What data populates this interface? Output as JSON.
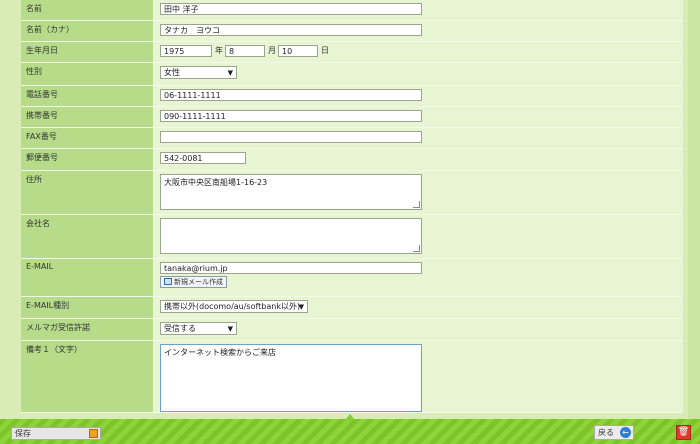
{
  "form": {
    "name": {
      "label": "名前",
      "value": "田中 洋子"
    },
    "kana": {
      "label": "名前（カナ）",
      "value": "タナカ　ヨウコ"
    },
    "birthday": {
      "label": "生年月日",
      "year": "1975",
      "year_unit": "年",
      "month": "8",
      "month_unit": "月",
      "day": "10",
      "day_unit": "日"
    },
    "gender": {
      "label": "性別",
      "value": "女性"
    },
    "phone": {
      "label": "電話番号",
      "value": "06-1111-1111"
    },
    "mobile": {
      "label": "携帯番号",
      "value": "090-1111-1111"
    },
    "fax": {
      "label": "FAX番号",
      "value": ""
    },
    "zip": {
      "label": "郵便番号",
      "value": "542-0081"
    },
    "address": {
      "label": "住所",
      "value": "大阪市中央区南船場1-16-23"
    },
    "company": {
      "label": "会社名",
      "value": ""
    },
    "email": {
      "label": "E-MAIL",
      "value": "tanaka@rium.jp",
      "new_mail_button": "新規メール作成"
    },
    "email_type": {
      "label": "E-MAIL種別",
      "value": "携帯以外(docomo/au/softbank以外)"
    },
    "magazine": {
      "label": "メルマガ受信許諾",
      "value": "受信する"
    },
    "note1": {
      "label": "備考１（文字）",
      "value": "インターネット検索からご来店"
    }
  },
  "footer": {
    "save_label": "保存",
    "back_label": "戻る"
  },
  "icons": {
    "lock": "lock-icon",
    "back": "back-arrow-icon",
    "trash": "trash-icon",
    "mail": "mail-icon"
  },
  "colors": {
    "accent_green": "#7ec32a",
    "label_bg": "#b6dc8a",
    "value_bg": "#e8f5d2",
    "trash_red": "#e03a2a",
    "back_blue": "#2c7fd1"
  }
}
